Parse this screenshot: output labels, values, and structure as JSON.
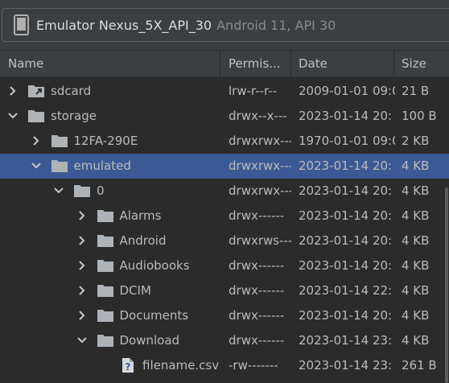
{
  "device": {
    "name": "Emulator Nexus_5X_API_30",
    "os": "Android 11, API 30"
  },
  "columns": {
    "name": "Name",
    "permissions": "Permis...",
    "date": "Date",
    "size": "Size"
  },
  "rows": [
    {
      "name": "sdcard",
      "perm": "lrw-r--r--",
      "date": "2009-01-01 09:0",
      "size": "21 B"
    },
    {
      "name": "storage",
      "perm": "drwx--x---",
      "date": "2023-01-14 20:",
      "size": "100 B"
    },
    {
      "name": "12FA-290E",
      "perm": "drwxrwx---",
      "date": "1970-01-01 09:0",
      "size": "2 KB"
    },
    {
      "name": "emulated",
      "perm": "drwxrwx---",
      "date": "2023-01-14 20:",
      "size": "4 KB"
    },
    {
      "name": "0",
      "perm": "drwxrwx---",
      "date": "2023-01-14 20:",
      "size": "4 KB"
    },
    {
      "name": "Alarms",
      "perm": "drwx------",
      "date": "2023-01-14 20:",
      "size": "4 KB"
    },
    {
      "name": "Android",
      "perm": "drwxrws---",
      "date": "2023-01-14 20:",
      "size": "4 KB"
    },
    {
      "name": "Audiobooks",
      "perm": "drwx------",
      "date": "2023-01-14 20:",
      "size": "4 KB"
    },
    {
      "name": "DCIM",
      "perm": "drwx------",
      "date": "2023-01-14 22:",
      "size": "4 KB"
    },
    {
      "name": "Documents",
      "perm": "drwx------",
      "date": "2023-01-14 20:",
      "size": "4 KB"
    },
    {
      "name": "Download",
      "perm": "drwx------",
      "date": "2023-01-14 23:",
      "size": "4 KB"
    },
    {
      "name": "filename.csv",
      "perm": "-rw-------",
      "date": "2023-01-14 23:",
      "size": "261 B"
    }
  ],
  "icons": {
    "folder": "folder-icon",
    "link_folder": "folder-link-icon",
    "file": "unknown-file-icon",
    "expand": "chevron-icon"
  },
  "colors": {
    "background": "#2b2b2b",
    "selection": "#3b5a95",
    "folder": "#aeb3b8"
  }
}
